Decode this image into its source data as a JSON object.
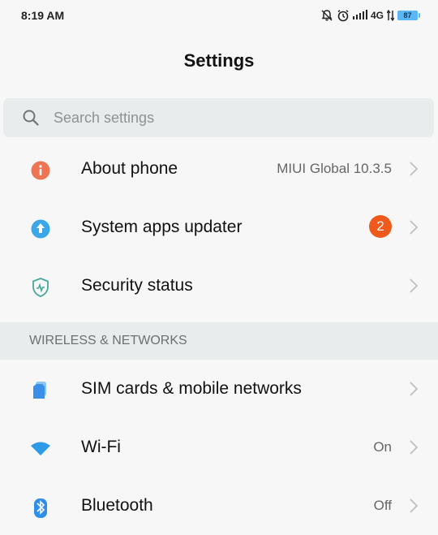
{
  "status_bar": {
    "time": "8:19 AM",
    "network": "4G",
    "battery": "87",
    "icons": [
      "mute-bell-icon",
      "alarm-icon",
      "signal-icon",
      "data-arrows-icon",
      "battery-icon"
    ]
  },
  "header": {
    "title": "Settings"
  },
  "search": {
    "placeholder": "Search settings"
  },
  "items": [
    {
      "label": "About phone",
      "value": "MIUI Global 10.3.5",
      "icon": "info-icon",
      "icon_color": "#ee7553"
    },
    {
      "label": "System apps updater",
      "badge": "2",
      "icon": "update-arrow-icon",
      "icon_color": "#3aa7e8"
    },
    {
      "label": "Security status",
      "icon": "shield-icon",
      "icon_color": "#46a89a"
    }
  ],
  "section": {
    "title": "WIRELESS & NETWORKS"
  },
  "network_items": [
    {
      "label": "SIM cards & mobile networks",
      "icon": "sim-card-icon",
      "icon_color": "#3a8fe8"
    },
    {
      "label": "Wi-Fi",
      "value": "On",
      "icon": "wifi-icon",
      "icon_color": "#2f9be8"
    },
    {
      "label": "Bluetooth",
      "value": "Off",
      "icon": "bluetooth-icon",
      "icon_color": "#2f8fe8"
    }
  ],
  "colors": {
    "background": "#f7f7f7",
    "search_background": "#e9ecec",
    "badge": "#ef5a1c",
    "battery": "#5ab6f5"
  }
}
